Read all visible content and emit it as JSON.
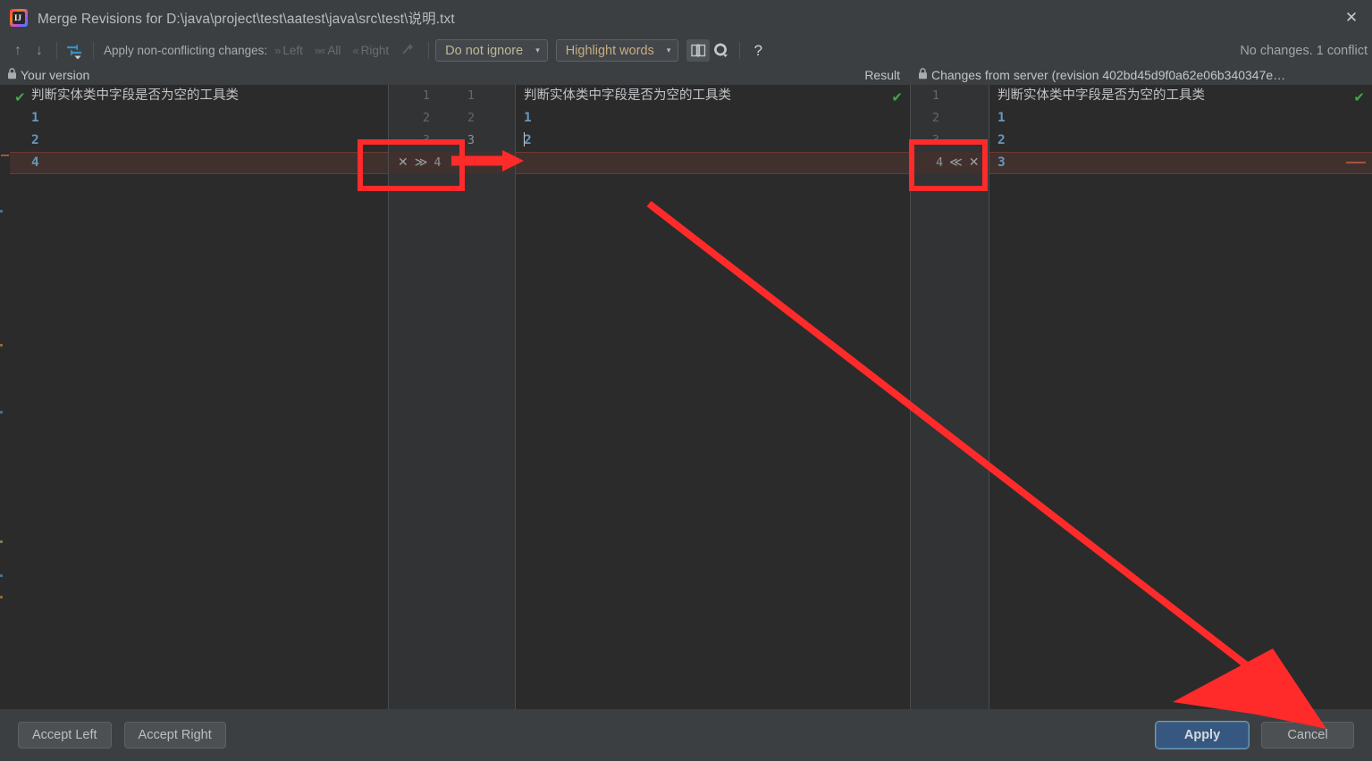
{
  "window": {
    "title": "Merge Revisions for D:\\java\\project\\test\\aatest\\java\\src\\test\\说明.txt",
    "close_label": "✕",
    "icon_text": "IJ"
  },
  "toolbar": {
    "prev_label": "↑",
    "next_label": "↓",
    "apply_nonconflicting_label": "Apply non-conflicting changes:",
    "left_label": "Left",
    "all_label": "All",
    "right_label": "Right",
    "ignore_combo": "Do not ignore",
    "highlight_combo": "Highlight words",
    "caret": "▾",
    "help_label": "?",
    "status": "No changes. 1 conflict",
    "icons": {
      "sync": "sync-scroll-icon",
      "magic": "magic-resolve-icon",
      "columns": "collapse-unchanged-icon",
      "gear": "settings-icon"
    }
  },
  "panes": {
    "left": {
      "header": "Your version",
      "lock": "🔒",
      "lines": [
        {
          "text": "判断实体类中字段是否为空的工具类",
          "kind": "cjk",
          "conflict": false
        },
        {
          "text": "1",
          "kind": "num",
          "conflict": false
        },
        {
          "text": "2",
          "kind": "num",
          "conflict": false
        },
        {
          "text": "4",
          "kind": "num",
          "conflict": true
        }
      ],
      "gutter_numbers": [
        "1",
        "2",
        "3",
        "4"
      ],
      "action": {
        "reject": "✕",
        "accept": "≫",
        "number": "4"
      }
    },
    "center": {
      "header": "Result",
      "lines": [
        {
          "text": "判断实体类中字段是否为空的工具类",
          "kind": "cjk",
          "conflict": false
        },
        {
          "text": "1",
          "kind": "num",
          "conflict": false
        },
        {
          "text": "2",
          "kind": "num",
          "conflict": false,
          "caret": true
        },
        {
          "text": "",
          "kind": "num",
          "conflict": true
        }
      ],
      "gutter_numbers_left": [
        "1",
        "2",
        "3"
      ],
      "gutter_numbers_right": [
        "1",
        "2",
        "3"
      ]
    },
    "right": {
      "header": "Changes from server (revision 402bd45d9f0a62e06b340347e…",
      "lock": "🔒",
      "lines": [
        {
          "text": "判断实体类中字段是否为空的工具类",
          "kind": "cjk",
          "conflict": false
        },
        {
          "text": "1",
          "kind": "num",
          "conflict": false
        },
        {
          "text": "2",
          "kind": "num",
          "conflict": false
        },
        {
          "text": "3",
          "kind": "num",
          "conflict": true
        }
      ],
      "gutter_numbers": [
        "1",
        "2",
        "3",
        "4"
      ],
      "action": {
        "number": "4",
        "accept": "≪",
        "reject": "✕"
      }
    }
  },
  "footer": {
    "accept_left": "Accept Left",
    "accept_right": "Accept Right",
    "apply": "Apply",
    "cancel": "Cancel"
  },
  "colors": {
    "window_bg": "#3c3f41",
    "editor_bg": "#2b2b2b",
    "gutter_bg": "#313335",
    "conflict_bg": "#40312e",
    "conflict_border": "#6e3a31",
    "accent_blue": "#365880",
    "ok_green": "#3fa84a",
    "annotation_red": "#ff2a2a",
    "number_token": "#6897bb"
  }
}
